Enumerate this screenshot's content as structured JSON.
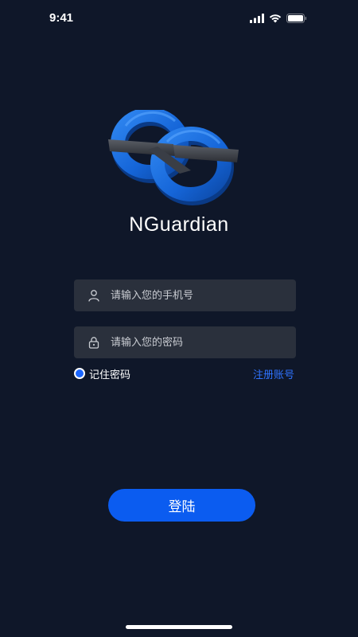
{
  "status_bar": {
    "time": "9:41",
    "icons": [
      "signal-icon",
      "wifi-icon",
      "battery-icon"
    ]
  },
  "app": {
    "name": "NGuardian",
    "logo": "nguardian-logo"
  },
  "login_form": {
    "phone_placeholder": "请输入您的手机号",
    "phone_value": "",
    "phone_icon": "user-icon",
    "password_placeholder": "请输入您的密码",
    "password_value": "",
    "password_icon": "lock-icon",
    "remember_label": "记住密码",
    "remember_checked": true,
    "register_label": "注册账号",
    "login_label": "登陆"
  },
  "colors": {
    "background": "#0f1729",
    "field_background": "#2a303c",
    "accent": "#0b5cf0",
    "link": "#2f73ff",
    "logo_blue": "#1a6fe0"
  }
}
